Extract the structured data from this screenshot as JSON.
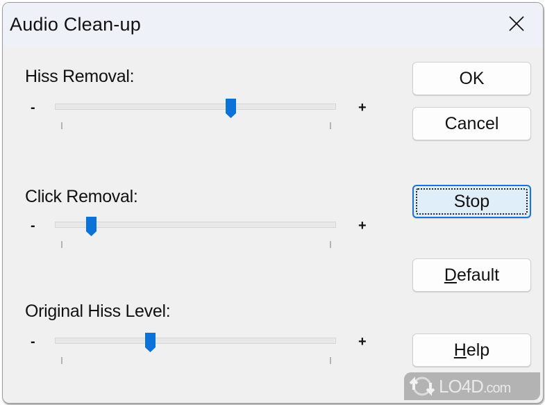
{
  "window": {
    "title": "Audio Clean-up",
    "close_icon": "close-icon"
  },
  "sliders": [
    {
      "label": "Hiss Removal:",
      "min_label": "-",
      "max_label": "+",
      "value": 0.63
    },
    {
      "label": "Click Removal:",
      "min_label": "-",
      "max_label": "+",
      "value": 0.11
    },
    {
      "label": "Original Hiss Level:",
      "min_label": "-",
      "max_label": "+",
      "value": 0.33
    }
  ],
  "buttons": {
    "ok": "OK",
    "cancel": "Cancel",
    "stop": "Stop",
    "default_mnemonic": "D",
    "default_rest": "efault",
    "help_mnemonic": "H",
    "help_rest": "elp"
  },
  "colors": {
    "accent": "#0a72d8",
    "titlebar": "#eef2f8",
    "body": "#f0f0f0"
  },
  "watermark": {
    "brand": "LO4D",
    "suffix": ".com"
  }
}
